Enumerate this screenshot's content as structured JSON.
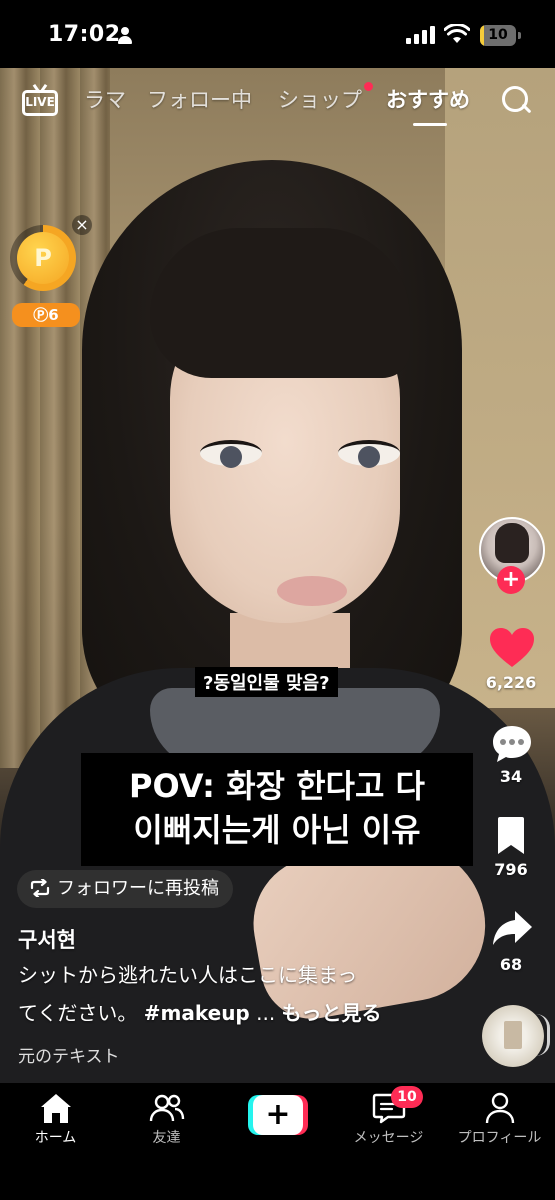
{
  "status_bar": {
    "time": "17:02",
    "battery_level": "10",
    "battery_fraction": 0.1,
    "icons": [
      "person-icon",
      "signal-icon",
      "wifi-icon",
      "battery-icon"
    ]
  },
  "top_nav": {
    "live_label": "LIVE",
    "tabs": [
      {
        "label": "ラマ",
        "active": false
      },
      {
        "label": "フォロー中",
        "active": false
      },
      {
        "label": "ショップ",
        "active": false,
        "dot": true
      },
      {
        "label": "おすすめ",
        "active": true
      }
    ],
    "search_icon": "search-icon"
  },
  "coin_widget": {
    "coin_symbol": "P",
    "close_symbol": "×",
    "badge": "Ⓟ6",
    "progress_fraction": 0.6,
    "accent": "#f5a623"
  },
  "video": {
    "small_caption": "?동일인물 맞음?",
    "pov_lines": [
      "POV: 화장 한다고 다",
      "이뻐지는게 아닌 이유"
    ]
  },
  "actions": {
    "follow_symbol": "+",
    "likes": "6,226",
    "comments": "34",
    "saves": "796",
    "shares": "68"
  },
  "post": {
    "repost_label": "フォロワーに再投稿",
    "username": "구서현",
    "description_line1": "シットから逃れたい人はここに集まっ",
    "description_line2_prefix": "てください。 ",
    "hashtag": "#makeup",
    "ellipsis": " ... ",
    "more": "もっと見る",
    "original_text": "元のテキスト"
  },
  "bottom_nav": {
    "items": [
      {
        "label": "ホーム",
        "icon": "home-icon",
        "active": true
      },
      {
        "label": "友達",
        "icon": "friends-icon",
        "active": false
      },
      {
        "label": "",
        "icon": "create-icon",
        "active": false
      },
      {
        "label": "メッセージ",
        "icon": "inbox-icon",
        "active": false
      },
      {
        "label": "プロフィール",
        "icon": "profile-icon",
        "active": false
      }
    ],
    "create_symbol": "+",
    "inbox_badge": "10"
  },
  "colors": {
    "accent_red": "#fe2c55",
    "accent_cyan": "#25f4ee",
    "coin_orange": "#f5901e"
  }
}
